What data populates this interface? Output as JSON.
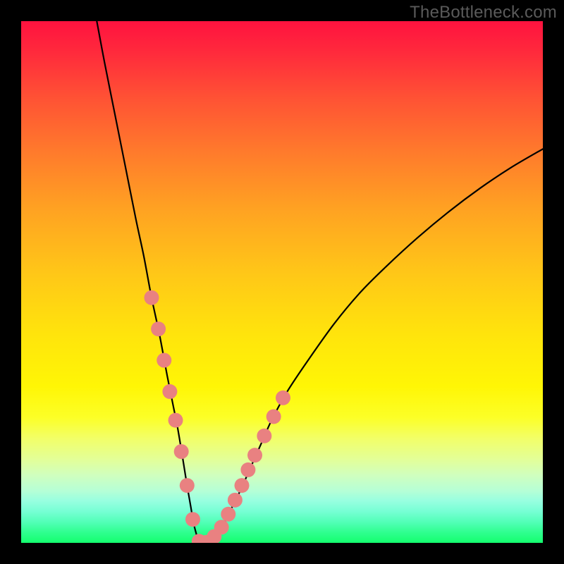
{
  "attribution": "TheBottleneck.com",
  "colors": {
    "background": "#000000",
    "curve_stroke": "#000000",
    "dot_fill": "#e98181",
    "attribution_text": "#5a5a5a"
  },
  "chart_data": {
    "type": "line",
    "title": "",
    "xlabel": "",
    "ylabel": "",
    "xlim": [
      0,
      100
    ],
    "ylim": [
      0,
      100
    ],
    "grid": false,
    "legend": false,
    "annotations": [],
    "series": [
      {
        "name": "bottleneck-curve",
        "x": [
          14.5,
          16,
          18,
          20,
          22,
          23.5,
          25,
          26.5,
          28,
          29,
          30,
          31,
          31.8,
          32.5,
          33,
          33.5,
          34,
          35,
          36,
          37,
          38,
          39,
          40,
          42,
          44,
          46,
          48,
          51,
          55,
          60,
          65,
          70,
          76,
          82,
          88,
          94,
          100
        ],
        "y": [
          100,
          92,
          82,
          72,
          62,
          55,
          47,
          40,
          32,
          27,
          22,
          16,
          11,
          7,
          4,
          2,
          0.5,
          0,
          0.4,
          1.2,
          2.4,
          4,
          6,
          10,
          14.5,
          19,
          23.5,
          29,
          35,
          42,
          48,
          53,
          58.5,
          63.5,
          68,
          72,
          75.5
        ]
      }
    ],
    "dots": {
      "name": "highlighted-range-dots",
      "points": [
        {
          "x": 25.0,
          "y": 47.0
        },
        {
          "x": 26.3,
          "y": 41.0
        },
        {
          "x": 27.4,
          "y": 35.0
        },
        {
          "x": 28.5,
          "y": 29.0
        },
        {
          "x": 29.6,
          "y": 23.5
        },
        {
          "x": 30.7,
          "y": 17.5
        },
        {
          "x": 31.8,
          "y": 11.0
        },
        {
          "x": 32.9,
          "y": 4.5
        },
        {
          "x": 34.1,
          "y": 0.3
        },
        {
          "x": 35.5,
          "y": 0.1
        },
        {
          "x": 37.0,
          "y": 1.2
        },
        {
          "x": 38.4,
          "y": 3.0
        },
        {
          "x": 39.7,
          "y": 5.5
        },
        {
          "x": 41.0,
          "y": 8.2
        },
        {
          "x": 42.3,
          "y": 11.0
        },
        {
          "x": 43.5,
          "y": 14.0
        },
        {
          "x": 44.8,
          "y": 16.8
        },
        {
          "x": 46.6,
          "y": 20.5
        },
        {
          "x": 48.4,
          "y": 24.2
        },
        {
          "x": 50.2,
          "y": 27.8
        }
      ]
    }
  }
}
